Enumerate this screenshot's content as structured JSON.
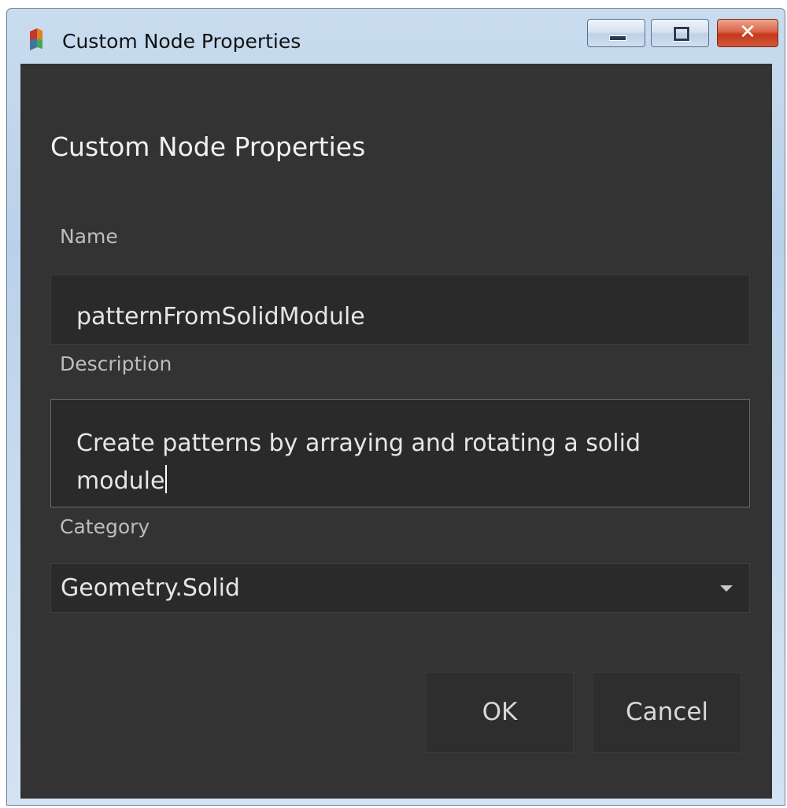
{
  "window": {
    "title": "Custom Node Properties",
    "icon": "dynamo-app-icon",
    "controls": {
      "minimize": "minimize-icon",
      "maximize": "maximize-icon",
      "close": "close-icon"
    },
    "close_glyph": "✕"
  },
  "dialog": {
    "heading": "Custom Node Properties",
    "name": {
      "label": "Name",
      "value": "patternFromSolidModule"
    },
    "description": {
      "label": "Description",
      "value": "Create patterns by arraying and rotating a solid module"
    },
    "category": {
      "label": "Category",
      "selected": "Geometry.Solid"
    },
    "buttons": {
      "ok": "OK",
      "cancel": "Cancel"
    }
  },
  "colors": {
    "dialog_background": "#333333",
    "field_background": "#2a2a2a",
    "text": "#e6e6e6",
    "label_text": "#bdbdbd",
    "close_button": "#c4381c"
  }
}
